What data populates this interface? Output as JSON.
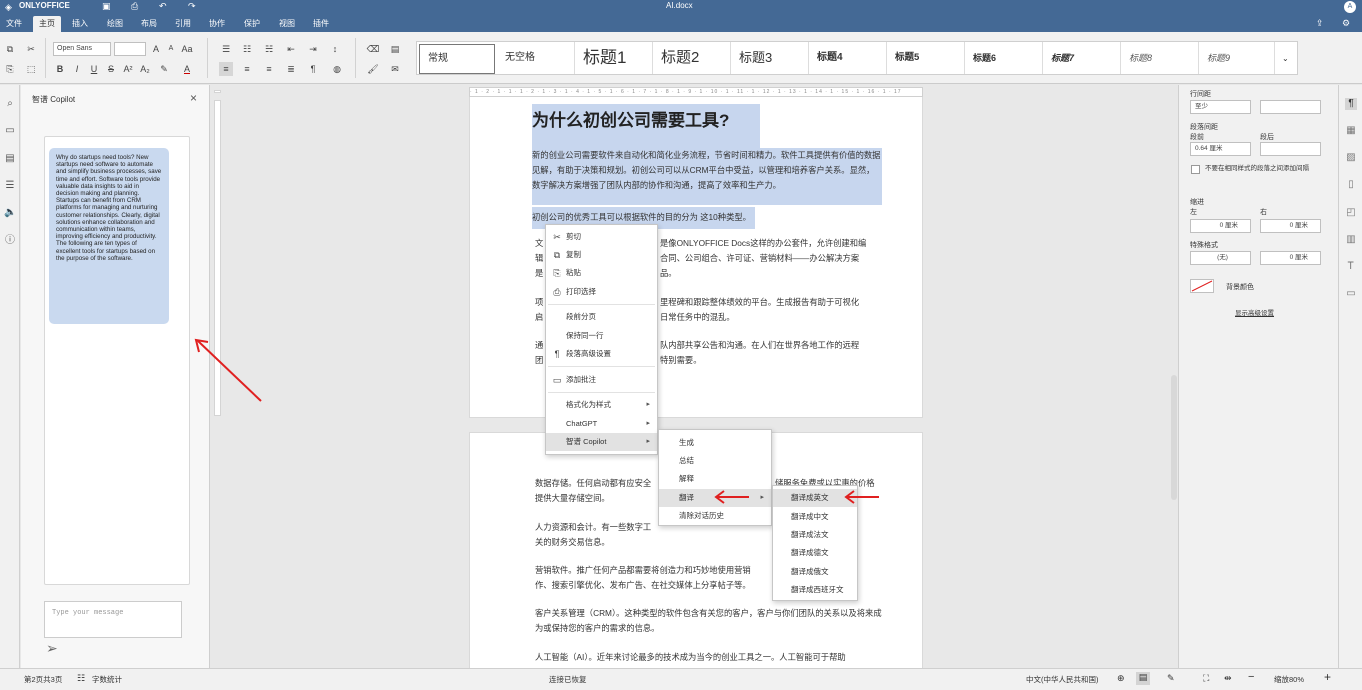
{
  "app": {
    "name": "ONLYOFFICE",
    "doc_title": "AI.docx",
    "user_initial": "A"
  },
  "menu": [
    "文件",
    "主页",
    "插入",
    "绘图",
    "布局",
    "引用",
    "协作",
    "保护",
    "视图",
    "插件"
  ],
  "menu_active": "主页",
  "toolbar": {
    "font_name": "Open Sans",
    "font_size": "",
    "styles": [
      "常规",
      "无空格",
      "标题1",
      "标题2",
      "标题3",
      "标题4",
      "标题5",
      "标题6",
      "标题7",
      "标题8",
      "标题9"
    ]
  },
  "copilot": {
    "title": "智谱 Copilot",
    "close": "×",
    "message": "Why do startups need tools? New startups need software to automate and simplify business processes, save time and effort. Software tools provide valuable data insights to aid in decision making and planning. Startups can benefit from CRM platforms for managing and nurturing customer relationships. Clearly, digital solutions enhance collaboration and communication within teams, improving efficiency and productivity. The following are ten types of excellent tools for startups based on the purpose of the software.",
    "input_placeholder": "Type your message"
  },
  "document": {
    "heading": "为什么初创公司需要工具?",
    "p1": "新的创业公司需要软件来自动化和简化业务流程，节省时间和精力。软件工具提供有价值的数据见解，有助于决策和规划。初创公司可以从CRM平台中受益，以管理和培养客户关系。显然，数字解决方案增强了团队内部的协作和沟通，提高了效率和生产力。",
    "p2": "初创公司的优秀工具可以根据软件的目的分为 这10种类型。",
    "p3a": "文",
    "p3b": "是像ONLYOFFICE Docs这样的办公套件，允许创建和编",
    "p3c": "辑",
    "p3d": "合同、公司组合、许可证、营销材料——办公解决方案",
    "p3e": "是",
    "p3f": "品。",
    "p4a": "项",
    "p4b": "里程碑和跟踪整体绩效的平台。生成报告有助于可视化",
    "p4c": "启",
    "p4d": "日常任务中的混乱。",
    "p5a": "通",
    "p5b": "队内部共享公告和沟通。在人们在世界各地工作的远程",
    "p5c": "团",
    "p5d": "特别需要。",
    "p6a": "数据存储。任何启动都有应安全",
    "p6b": "储服务免费或以实惠的价格",
    "p6c": "提供大量存储空间。",
    "p7a": "人力资源和会计。有一些数字工",
    "p7b": "关的财务交易信息。",
    "p8a": "营销软件。推广任何产品都需要将创造力和巧妙地使用营销",
    "p8b": "作、搜索引擎优化、发布广告、在社交媒体上分享帖子等。",
    "p9": "客户关系管理（CRM）。这种类型的软件包含有关您的客户，客户与你们团队的关系以及将来成为或保持您的客户的需求的信息。",
    "p10": "人工智能（AI）。近年来讨论最多的技术成为当今的创业工具之一。人工智能可于帮助"
  },
  "context_menu": {
    "items": [
      {
        "icon": "cut-icon",
        "glyph": "✂",
        "label": "剪切"
      },
      {
        "icon": "copy-icon",
        "glyph": "⧉",
        "label": "复制"
      },
      {
        "icon": "paste-icon",
        "glyph": "📋",
        "label": "粘贴"
      },
      {
        "icon": "print-icon",
        "glyph": "⎙",
        "label": "打印选择"
      },
      {
        "icon": "",
        "glyph": "",
        "label": "段前分页"
      },
      {
        "icon": "",
        "glyph": "",
        "label": "保持同一行"
      },
      {
        "icon": "paragraph-icon",
        "glyph": "¶",
        "label": "段落高级设置"
      },
      {
        "icon": "comment-icon",
        "glyph": "▭",
        "label": "添加批注"
      },
      {
        "icon": "",
        "glyph": "",
        "label": "格式化为样式"
      },
      {
        "icon": "",
        "glyph": "",
        "label": "ChatGPT"
      },
      {
        "icon": "",
        "glyph": "",
        "label": "智谱 Copilot"
      }
    ]
  },
  "submenu1": {
    "items": [
      "生成",
      "总结",
      "解释",
      "翻译",
      "清除对话历史"
    ]
  },
  "submenu2": {
    "items": [
      "翻译成英文",
      "翻译成中文",
      "翻译成法文",
      "翻译成德文",
      "翻译成俄文",
      "翻译成西班牙文"
    ]
  },
  "paragraph_settings": {
    "line_spacing_label": "行间距",
    "line_spacing_value": "至少",
    "para_spacing_label": "段落间距",
    "before_label": "段前",
    "after_label": "段后",
    "before_value": "0.64 厘米",
    "dont_add_space": "不要在相同样式的段落之间添加间隔",
    "indent_label": "缩进",
    "left_label": "左",
    "right_label": "右",
    "left_value": "0 厘米",
    "right_value": "0 厘米",
    "special_label": "特殊格式",
    "special_value": "(无)",
    "special_size": "0 厘米",
    "bg_color_label": "背景颜色",
    "advanced_link": "显示高级设置"
  },
  "status": {
    "page": "第2页共3页",
    "word_count": "字数统计",
    "connection": "连接已恢复",
    "language": "中文(中华人民共和国)",
    "zoom": "缩放80%"
  },
  "colors": {
    "brand": "#446995",
    "selection": "#c7d6ee",
    "annotation": "#e02020"
  }
}
